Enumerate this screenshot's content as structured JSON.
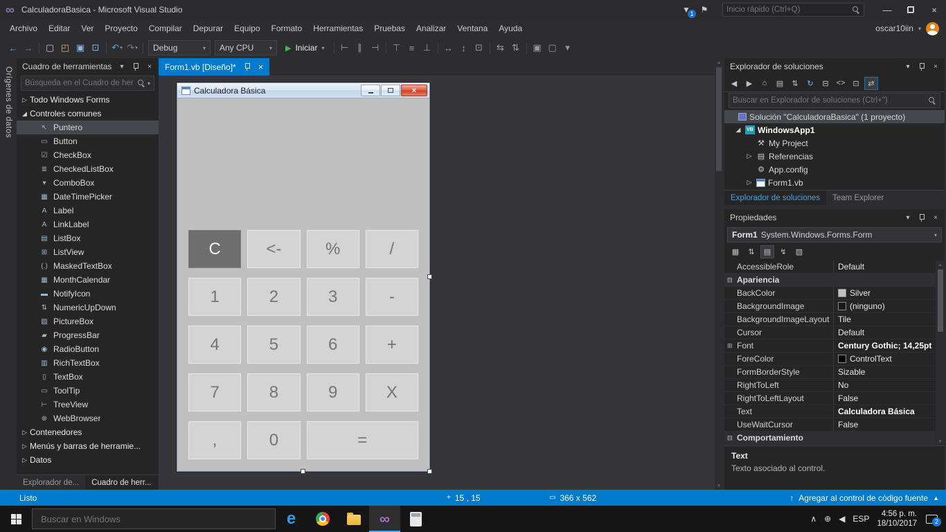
{
  "colors": {
    "accent": "#007acc",
    "form_background": "#c0c0c0",
    "calc_button": "#d4d4d4",
    "calc_button_dark": "#6e6e6e",
    "close_button_red": "#c8432c"
  },
  "icons": {
    "vs_logo": "∞",
    "funnel": "▼",
    "feedback_flag": "⚑",
    "minimize": "—",
    "close": "×",
    "caret_down": "▾",
    "play": "▶",
    "status_up_arrow": "↑",
    "status_triangle": "▲",
    "position": "+",
    "size": "▭",
    "scroll_up": "▴",
    "scroll_down": "▾",
    "tray_chevron": "∧",
    "tray_network": "⊕",
    "tray_volume": "◀",
    "edge_logo": "e",
    "vs_taskbar_logo": "∞"
  },
  "window": {
    "title": "CalculadoraBasica - Microsoft Visual Studio",
    "quick_launch_placeholder": "Inicio rápido (Ctrl+Q)",
    "notifications": "1",
    "user": "oscar10iin"
  },
  "menu": {
    "items": [
      {
        "label": "Archivo"
      },
      {
        "label": "Editar"
      },
      {
        "label": "Ver"
      },
      {
        "label": "Proyecto"
      },
      {
        "label": "Compilar"
      },
      {
        "label": "Depurar"
      },
      {
        "label": "Equipo"
      },
      {
        "label": "Formato"
      },
      {
        "label": "Herramientas"
      },
      {
        "label": "Pruebas"
      },
      {
        "label": "Analizar"
      },
      {
        "label": "Ventana"
      },
      {
        "label": "Ayuda"
      }
    ]
  },
  "toolbar": {
    "main_icons": [
      {
        "name": "nav-back-icon",
        "glyph": "←",
        "color": "#5fa8e0"
      },
      {
        "name": "nav-forward-icon",
        "glyph": "→",
        "color": "#7d7d7d"
      },
      {
        "sep": true
      },
      {
        "name": "new-file-icon",
        "glyph": "▢",
        "color": "#c8c8c8"
      },
      {
        "name": "open-file-icon",
        "glyph": "◰",
        "color": "#cdb06a"
      },
      {
        "name": "save-icon",
        "glyph": "▣",
        "color": "#8ab6e8"
      },
      {
        "name": "save-all-icon",
        "glyph": "⊡",
        "color": "#8ab6e8"
      },
      {
        "sep": true
      },
      {
        "name": "undo-icon",
        "glyph": "↶",
        "color": "#5fa8e0",
        "caret": "▾"
      },
      {
        "name": "redo-icon",
        "glyph": "↷",
        "color": "#7d7d7d",
        "caret": "▾"
      },
      {
        "sep": true
      }
    ],
    "debug_config": "Debug",
    "cpu_config": "Any CPU",
    "start_label": "Iniciar",
    "layout_icons": [
      {
        "sep": true
      },
      {
        "name": "align-lefts-icon",
        "glyph": "⊢"
      },
      {
        "name": "align-centers-icon",
        "glyph": "∥"
      },
      {
        "name": "align-rights-icon",
        "glyph": "⊣"
      },
      {
        "sep": true
      },
      {
        "name": "align-tops-icon",
        "glyph": "⊤"
      },
      {
        "name": "align-middles-icon",
        "glyph": "≡"
      },
      {
        "name": "align-bottoms-icon",
        "glyph": "⊥"
      },
      {
        "sep": true
      },
      {
        "name": "same-width-icon",
        "glyph": "↔"
      },
      {
        "name": "same-height-icon",
        "glyph": "↕"
      },
      {
        "name": "same-size-icon",
        "glyph": "⊡"
      },
      {
        "sep": true
      },
      {
        "name": "horizontal-spacing-icon",
        "glyph": "⇆"
      },
      {
        "name": "vertical-spacing-icon",
        "glyph": "⇅"
      },
      {
        "sep": true
      },
      {
        "name": "bring-to-front-icon",
        "glyph": "▣"
      },
      {
        "name": "send-to-back-icon",
        "glyph": "▢"
      },
      {
        "name": "toolbar-overflow-icon",
        "glyph": "▾"
      }
    ]
  },
  "left_strip": {
    "label": "Orígenes de datos"
  },
  "toolbox": {
    "title": "Cuadro de herramientas",
    "search_placeholder": "Búsqueda en el Cuadro de her",
    "rows": [
      {
        "label": "Todo Windows Forms",
        "is_group": true,
        "arrow": "▷"
      },
      {
        "label": "Controles comunes",
        "is_group": true,
        "arrow": "◢"
      },
      {
        "label": "Puntero",
        "icon": "pointer-icon",
        "glyph": "↖",
        "selected": true
      },
      {
        "label": "Button",
        "icon": "button-icon",
        "glyph": "▭"
      },
      {
        "label": "CheckBox",
        "icon": "checkbox-icon",
        "glyph": "☑"
      },
      {
        "label": "CheckedListBox",
        "icon": "checked-listbox-icon",
        "glyph": "≣"
      },
      {
        "label": "ComboBox",
        "icon": "combobox-icon",
        "glyph": "▾"
      },
      {
        "label": "DateTimePicker",
        "icon": "datetimepicker-icon",
        "glyph": "▦"
      },
      {
        "label": "Label",
        "icon": "label-icon",
        "glyph": "A"
      },
      {
        "label": "LinkLabel",
        "icon": "linklabel-icon",
        "glyph": "A"
      },
      {
        "label": "ListBox",
        "icon": "listbox-icon",
        "glyph": "▤"
      },
      {
        "label": "ListView",
        "icon": "listview-icon",
        "glyph": "⊞"
      },
      {
        "label": "MaskedTextBox",
        "icon": "maskedtextbox-icon",
        "glyph": "(.)"
      },
      {
        "label": "MonthCalendar",
        "icon": "monthcalendar-icon",
        "glyph": "▦"
      },
      {
        "label": "NotifyIcon",
        "icon": "notifyicon-icon",
        "glyph": "▬"
      },
      {
        "label": "NumericUpDown",
        "icon": "numericupdown-icon",
        "glyph": "⇅"
      },
      {
        "label": "PictureBox",
        "icon": "picturebox-icon",
        "glyph": "▨"
      },
      {
        "label": "ProgressBar",
        "icon": "progressbar-icon",
        "glyph": "▰"
      },
      {
        "label": "RadioButton",
        "icon": "radiobutton-icon",
        "glyph": "◉"
      },
      {
        "label": "RichTextBox",
        "icon": "richtextbox-icon",
        "glyph": "▥"
      },
      {
        "label": "TextBox",
        "icon": "textbox-icon",
        "glyph": "▯"
      },
      {
        "label": "ToolTip",
        "icon": "tooltip-icon",
        "glyph": "▭"
      },
      {
        "label": "TreeView",
        "icon": "treeview-icon",
        "glyph": "⊢"
      },
      {
        "label": "WebBrowser",
        "icon": "webbrowser-icon",
        "glyph": "⊕"
      },
      {
        "label": "Contenedores",
        "is_group": true,
        "arrow": "▷"
      },
      {
        "label": "Menús y barras de herramie...",
        "is_group": true,
        "arrow": "▷"
      },
      {
        "label": "Datos",
        "is_group": true,
        "arrow": "▷"
      }
    ],
    "bottom_tabs": [
      {
        "label": "Explorador de..."
      },
      {
        "label": "Cuadro de herr...",
        "active": true
      }
    ]
  },
  "designer": {
    "tab_label": "Form1.vb [Diseño]*",
    "form": {
      "title": "Calculadora Básica",
      "buttons": [
        {
          "label": "C",
          "dark": true
        },
        {
          "label": "<-"
        },
        {
          "label": "%"
        },
        {
          "label": "/"
        },
        {
          "label": "1"
        },
        {
          "label": "2"
        },
        {
          "label": "3"
        },
        {
          "label": "-"
        },
        {
          "label": "4"
        },
        {
          "label": "5"
        },
        {
          "label": "6"
        },
        {
          "label": "+"
        },
        {
          "label": "7"
        },
        {
          "label": "8"
        },
        {
          "label": "9"
        },
        {
          "label": "X"
        },
        {
          "label": ","
        },
        {
          "label": "0"
        },
        {
          "label": "=",
          "wide": true
        }
      ]
    }
  },
  "solution": {
    "title": "Explorador de soluciones",
    "search_placeholder": "Buscar en Explorador de soluciones (Ctrl+\")",
    "toolbar": [
      {
        "name": "nav-back-icon",
        "glyph": "◀"
      },
      {
        "name": "nav-forward-icon",
        "glyph": "▶"
      },
      {
        "name": "home-icon",
        "glyph": "⌂"
      },
      {
        "name": "show-all-files-icon",
        "glyph": "▤"
      },
      {
        "name": "pending-changes-icon",
        "glyph": "⇅"
      },
      {
        "name": "refresh-icon",
        "glyph": "↻",
        "color": "#6cb8f2"
      },
      {
        "name": "collapse-all-icon",
        "glyph": "⊟"
      },
      {
        "name": "view-code-icon",
        "glyph": "<>"
      },
      {
        "name": "properties-icon",
        "glyph": "⊡"
      },
      {
        "name": "sync-active-document-icon",
        "glyph": "⇄",
        "highlighted": true
      }
    ],
    "tree": [
      {
        "label": "Solución \"CalculadoraBasica\" (1 proyecto)",
        "ico": "solution",
        "icon_name": "solution-icon",
        "glyph": "",
        "arrow": "",
        "pad": "4px",
        "selected": true
      },
      {
        "label": "WindowsApp1",
        "ico": "vb",
        "icon_name": "vb-project-icon",
        "glyph": "",
        "arrow": "◢",
        "pad": "14px",
        "bold": true
      },
      {
        "label": "My Project",
        "ico": "wrench",
        "icon_name": "my-project-icon",
        "glyph": "⚒",
        "arrow": "",
        "pad": "30px"
      },
      {
        "label": "Referencias",
        "ico": "refs",
        "icon_name": "references-icon",
        "glyph": "▤",
        "arrow": "▷",
        "pad": "30px"
      },
      {
        "label": "App.config",
        "ico": "config",
        "icon_name": "app-config-icon",
        "glyph": "⚙",
        "arrow": "",
        "pad": "30px"
      },
      {
        "label": "Form1.vb",
        "ico": "form",
        "icon_name": "form-file-icon",
        "glyph": "",
        "arrow": "▷",
        "pad": "30px"
      }
    ],
    "bottom_tabs": [
      {
        "label": "Explorador de soluciones",
        "active": true
      },
      {
        "label": "Team Explorer"
      }
    ]
  },
  "properties": {
    "title": "Propiedades",
    "object_name": "Form1",
    "object_type": "System.Windows.Forms.Form",
    "toolbar": [
      {
        "name": "categorized-icon",
        "glyph": "▦"
      },
      {
        "name": "alphabetical-icon",
        "glyph": "⇅"
      },
      {
        "name": "properties-view-icon",
        "glyph": "▤",
        "selected": true
      },
      {
        "name": "events-icon",
        "glyph": "↯"
      },
      {
        "name": "property-pages-icon",
        "glyph": "▧"
      }
    ],
    "rows": [
      {
        "name": "AccessibleRole",
        "value": "Default"
      },
      {
        "name": "Apariencia",
        "is_category": true,
        "expander": "⊟"
      },
      {
        "name": "BackColor",
        "value": "Silver",
        "swatch": "#c0c0c0"
      },
      {
        "name": "BackgroundImage",
        "value": "(ninguno)",
        "swatch": "#1a1a1a"
      },
      {
        "name": "BackgroundImageLayout",
        "value": "Tile"
      },
      {
        "name": "Cursor",
        "value": "Default"
      },
      {
        "name": "Font",
        "value": "Century Gothic; 14,25pt",
        "expander": "⊞",
        "bold_value": true
      },
      {
        "name": "ForeColor",
        "value": "ControlText",
        "swatch": "#000000"
      },
      {
        "name": "FormBorderStyle",
        "value": "Sizable"
      },
      {
        "name": "RightToLeft",
        "value": "No"
      },
      {
        "name": "RightToLeftLayout",
        "value": "False"
      },
      {
        "name": "Text",
        "value": "Calculadora Básica",
        "bold_value": true
      },
      {
        "name": "UseWaitCursor",
        "value": "False"
      },
      {
        "name": "Comportamiento",
        "is_category": true,
        "expander": "⊟"
      }
    ],
    "description_title": "Text",
    "description_text": "Texto asociado al control."
  },
  "statusbar": {
    "left": "Listo",
    "position": "15 , 15",
    "size": "366 x 562",
    "right": "Agregar al control de código fuente"
  },
  "taskbar": {
    "search_placeholder": "Buscar en Windows",
    "language": "ESP",
    "time": "4:56 p. m.",
    "date": "18/10/2017",
    "notification_count": "2"
  }
}
